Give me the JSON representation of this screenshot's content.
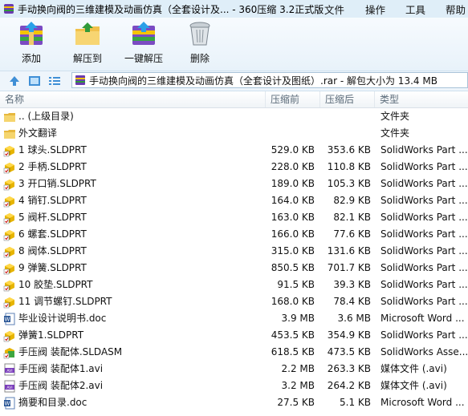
{
  "window": {
    "title": "手动换向阀的三维建模及动画仿真（全套设计及... - 360压缩 3.2正式版",
    "menu": [
      "文件",
      "操作",
      "工具",
      "帮助"
    ]
  },
  "toolbar": {
    "add_label": "添加",
    "extract_to_label": "解压到",
    "one_click_extract_label": "一键解压",
    "delete_label": "删除"
  },
  "address": {
    "text": "手动换向阀的三维建模及动画仿真（全套设计及图纸）.rar - 解包大小为 13.4 MB"
  },
  "columns": {
    "name": "名称",
    "packed": "压缩前",
    "size": "压缩后",
    "type": "类型"
  },
  "files": [
    {
      "icon": "folder-up-icon",
      "name": ".. (上级目录)",
      "packed": "",
      "size": "",
      "type": "文件夹"
    },
    {
      "icon": "folder-icon",
      "name": "外文翻译",
      "packed": "",
      "size": "",
      "type": "文件夹"
    },
    {
      "icon": "solidworks-part-icon",
      "name": "1 球头.SLDPRT",
      "packed": "529.0 KB",
      "size": "353.6 KB",
      "type": "SolidWorks Part ..."
    },
    {
      "icon": "solidworks-part-icon",
      "name": "2 手柄.SLDPRT",
      "packed": "228.0 KB",
      "size": "110.8 KB",
      "type": "SolidWorks Part ..."
    },
    {
      "icon": "solidworks-part-icon",
      "name": "3 开口销.SLDPRT",
      "packed": "189.0 KB",
      "size": "105.3 KB",
      "type": "SolidWorks Part ..."
    },
    {
      "icon": "solidworks-part-icon",
      "name": "4 销钉.SLDPRT",
      "packed": "164.0 KB",
      "size": "82.9 KB",
      "type": "SolidWorks Part ..."
    },
    {
      "icon": "solidworks-part-icon",
      "name": "5 阀杆.SLDPRT",
      "packed": "163.0 KB",
      "size": "82.1 KB",
      "type": "SolidWorks Part ..."
    },
    {
      "icon": "solidworks-part-icon",
      "name": "6 螺套.SLDPRT",
      "packed": "166.0 KB",
      "size": "77.6 KB",
      "type": "SolidWorks Part ..."
    },
    {
      "icon": "solidworks-part-icon",
      "name": "8 阀体.SLDPRT",
      "packed": "315.0 KB",
      "size": "131.6 KB",
      "type": "SolidWorks Part ..."
    },
    {
      "icon": "solidworks-part-icon",
      "name": "9 弹簧.SLDPRT",
      "packed": "850.5 KB",
      "size": "701.7 KB",
      "type": "SolidWorks Part ..."
    },
    {
      "icon": "solidworks-part-icon",
      "name": "10 胶垫.SLDPRT",
      "packed": "91.5 KB",
      "size": "39.3 KB",
      "type": "SolidWorks Part ..."
    },
    {
      "icon": "solidworks-part-icon",
      "name": "11 调节螺钉.SLDPRT",
      "packed": "168.0 KB",
      "size": "78.4 KB",
      "type": "SolidWorks Part ..."
    },
    {
      "icon": "word-doc-icon",
      "name": "毕业设计说明书.doc",
      "packed": "3.9 MB",
      "size": "3.6 MB",
      "type": "Microsoft Word ..."
    },
    {
      "icon": "solidworks-part-icon",
      "name": "弹簧1.SLDPRT",
      "packed": "453.5 KB",
      "size": "354.9 KB",
      "type": "SolidWorks Part ..."
    },
    {
      "icon": "solidworks-assembly-icon",
      "name": "手压阀 装配体.SLDASM",
      "packed": "618.5 KB",
      "size": "473.5 KB",
      "type": "SolidWorks Asse..."
    },
    {
      "icon": "avi-video-icon",
      "name": "手压阀 装配体1.avi",
      "packed": "2.2 MB",
      "size": "263.3 KB",
      "type": "媒体文件 (.avi)"
    },
    {
      "icon": "avi-video-icon",
      "name": "手压阀 装配体2.avi",
      "packed": "3.2 MB",
      "size": "264.2 KB",
      "type": "媒体文件 (.avi)"
    },
    {
      "icon": "word-doc-icon",
      "name": "摘要和目录.doc",
      "packed": "27.5 KB",
      "size": "5.1 KB",
      "type": "Microsoft Word ..."
    }
  ]
}
